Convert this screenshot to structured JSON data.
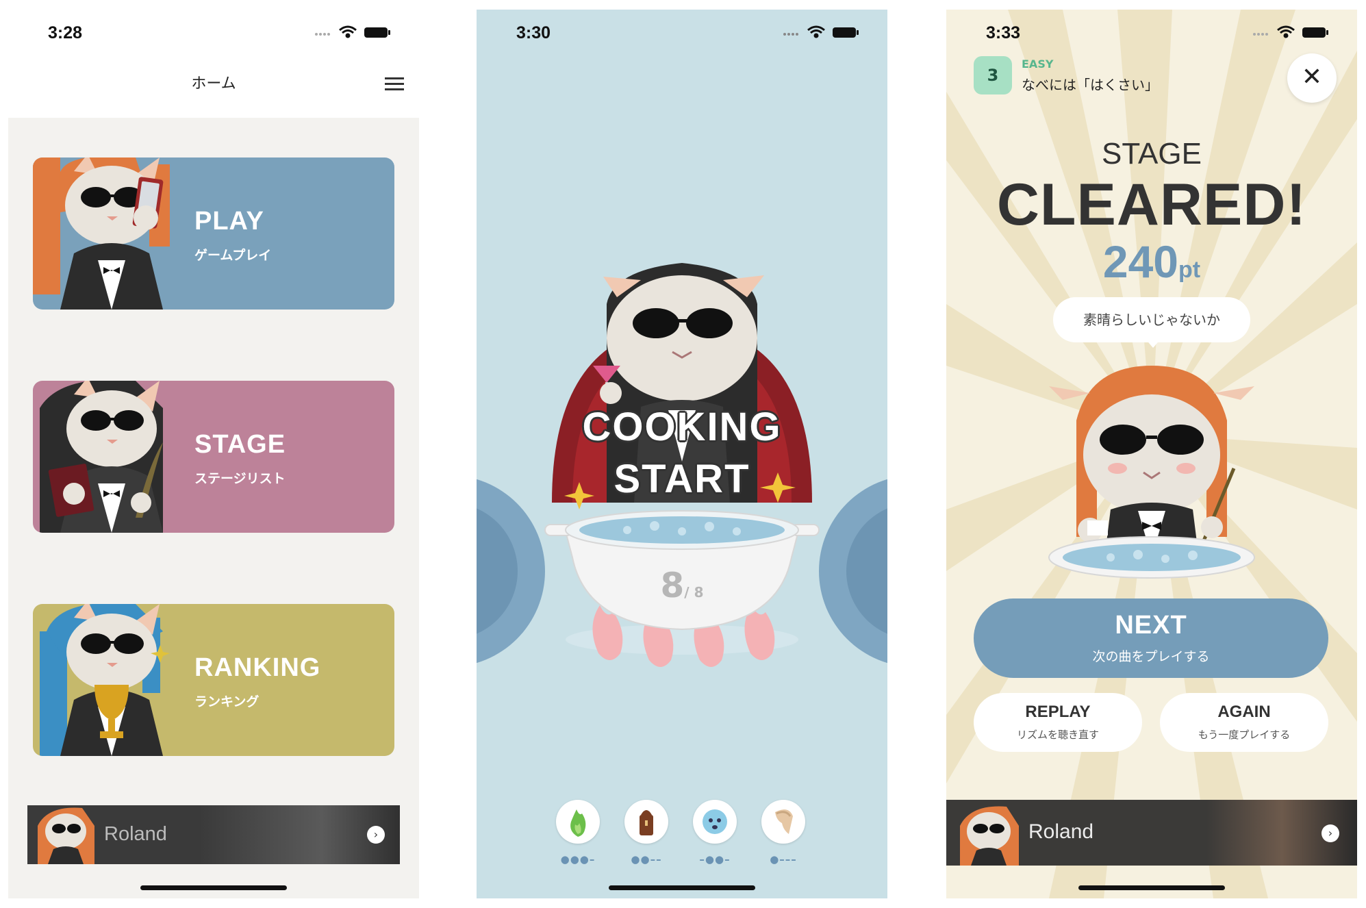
{
  "screens": {
    "home": {
      "time": "3:28",
      "title": "ホーム",
      "cards": [
        {
          "title": "PLAY",
          "subtitle": "ゲームプレイ",
          "color": "#7aa1bb"
        },
        {
          "title": "STAGE",
          "subtitle": "ステージリスト",
          "color": "#bd8299"
        },
        {
          "title": "RANKING",
          "subtitle": "ランキング",
          "color": "#c5b96c"
        }
      ],
      "banner": {
        "brand": "Roland"
      }
    },
    "game": {
      "time": "3:30",
      "cooking": "COOKING",
      "start": "START",
      "count": "8",
      "total": "/ 8",
      "ingredients": [
        {
          "icon": "flame-icon",
          "dots": "●●●–"
        },
        {
          "icon": "pepper-icon",
          "dots": "●●––"
        },
        {
          "icon": "fish-icon",
          "dots": "–●●–"
        },
        {
          "icon": "bag-icon",
          "dots": "●–––"
        }
      ]
    },
    "result": {
      "time": "3:33",
      "level_number": "3",
      "difficulty": "EASY",
      "song_title": "なべには「はくさい」",
      "close": "✕",
      "stage": "STAGE",
      "cleared": "CLEARED!",
      "score": "240",
      "score_unit": "pt",
      "message": "素晴らしいじゃないか",
      "next": {
        "label": "NEXT",
        "sub": "次の曲をプレイする"
      },
      "replay": {
        "label": "REPLAY",
        "sub": "リズムを聴き直す"
      },
      "again": {
        "label": "AGAIN",
        "sub": "もう一度プレイする"
      },
      "banner": {
        "brand": "Roland"
      }
    }
  },
  "colors": {
    "home_bg": "#f3f2ef",
    "game_bg": "#c9e0e6",
    "result_bg": "#f6f1e0",
    "accent_blue": "#759db9",
    "easy_green": "#57b68d"
  }
}
